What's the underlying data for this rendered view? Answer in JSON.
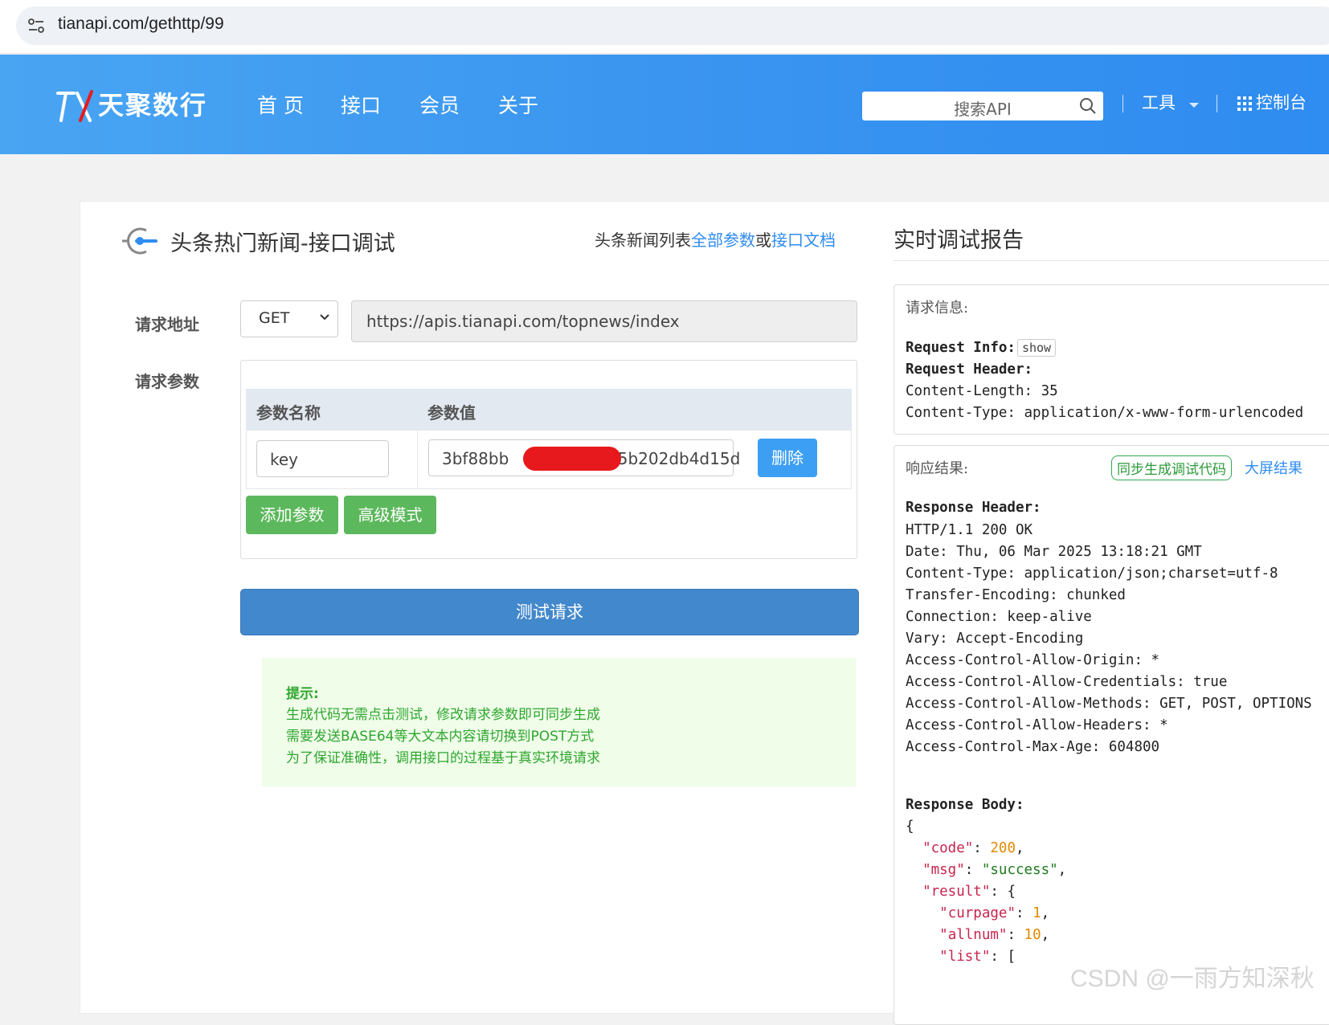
{
  "browser": {
    "url": "tianapi.com/gethttp/99"
  },
  "header": {
    "logo_text": "天聚数行",
    "nav": [
      "首 页",
      "接口",
      "会员",
      "关于"
    ],
    "search_placeholder": "搜索API",
    "tools_label": "工具",
    "console_label": "控制台"
  },
  "page": {
    "title": "头条热门新闻-接口调试",
    "doc_prefix": "头条新闻列表",
    "doc_link_params": "全部参数",
    "doc_or": "或",
    "doc_link_docs": "接口文档"
  },
  "form": {
    "url_label": "请求地址",
    "method": "GET",
    "api_url": "https://apis.tianapi.com/topnews/index",
    "params_label": "请求参数",
    "col_name": "参数名称",
    "col_value": "参数值",
    "param_name": "key",
    "param_value_prefix": "3bf88bb",
    "param_value_suffix": "05b202db4d15d",
    "delete_btn": "删除",
    "add_param_btn": "添加参数",
    "advanced_btn": "高级模式",
    "submit_btn": "测试请求"
  },
  "hint": {
    "title": "提示:",
    "lines": [
      "生成代码无需点击测试，修改请求参数即可同步生成",
      "需要发送BASE64等大文本内容请切换到POST方式",
      "为了保证准确性，调用接口的过程基于真实环境请求"
    ]
  },
  "report": {
    "title": "实时调试报告",
    "request_label": "请求信息:",
    "req_info_label": "Request Info:",
    "show_label": "show",
    "req_header_label": "Request Header:",
    "req_headers": [
      "Content-Length: 35",
      "Content-Type: application/x-www-form-urlencoded"
    ],
    "response_label": "响应结果:",
    "gen_code_tag": "同步生成调试代码",
    "fullscreen_link": "大屏结果",
    "resp_header_label": "Response Header:",
    "resp_headers": [
      "HTTP/1.1 200 OK",
      "Date: Thu, 06 Mar 2025 13:18:21 GMT",
      "Content-Type: application/json;charset=utf-8",
      "Transfer-Encoding: chunked",
      "Connection: keep-alive",
      "Vary: Accept-Encoding",
      "Access-Control-Allow-Origin: *",
      "Access-Control-Allow-Credentials: true",
      "Access-Control-Allow-Methods: GET, POST, OPTIONS",
      "Access-Control-Allow-Headers: *",
      "Access-Control-Max-Age: 604800"
    ],
    "resp_body_label": "Response Body:",
    "body": {
      "open": "{",
      "code_key": "\"code\"",
      "code_val": "200",
      "msg_key": "\"msg\"",
      "msg_val": "\"success\"",
      "result_key": "\"result\"",
      "result_open": "{",
      "curpage_key": "\"curpage\"",
      "curpage_val": "1",
      "allnum_key": "\"allnum\"",
      "allnum_val": "10",
      "list_key": "\"list\"",
      "list_open": "["
    }
  },
  "watermark": "CSDN @一雨方知深秋",
  "colors": {
    "header_blue": "#3a95f0",
    "link_blue": "#2f8cf0",
    "submit_blue": "#4288cc",
    "green_button": "#5cb85c",
    "redaction_red": "#e8191c"
  }
}
